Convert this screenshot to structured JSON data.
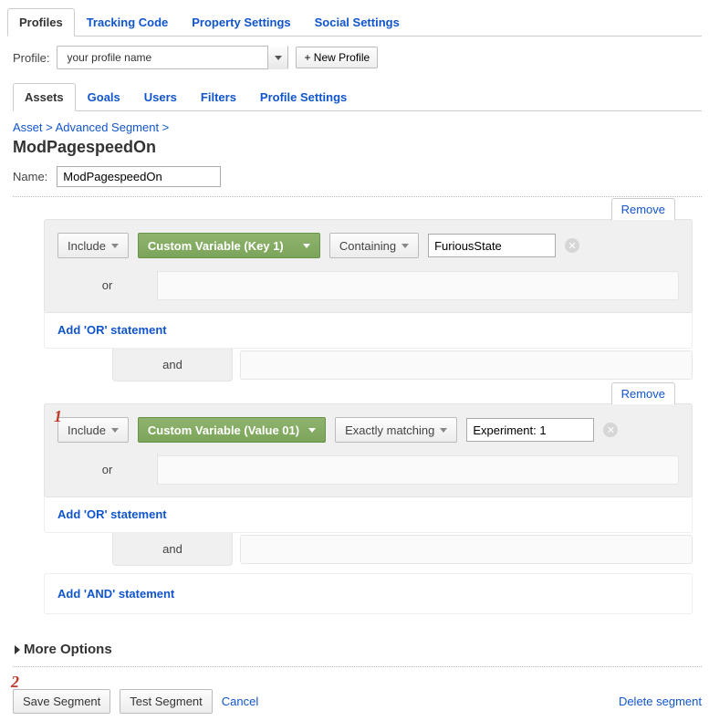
{
  "topTabs": [
    "Profiles",
    "Tracking Code",
    "Property Settings",
    "Social Settings"
  ],
  "topActive": "Profiles",
  "profileLabel": "Profile:",
  "profileValue": "your profile name",
  "newProfileLabel": "+ New Profile",
  "subTabs": [
    "Assets",
    "Goals",
    "Users",
    "Filters",
    "Profile Settings"
  ],
  "subActive": "Assets",
  "breadcrumb": "Asset > Advanced Segment >",
  "segmentTitle": "ModPagespeedOn",
  "nameLabel": "Name:",
  "nameValue": "ModPagespeedOn",
  "orLabel": "or",
  "andLabel": "and",
  "addOrLabel": "Add 'OR' statement",
  "addAndLabel": "Add 'AND' statement",
  "removeLabel": "Remove",
  "rules": [
    {
      "include": "Include",
      "variable": "Custom Variable (Key 1)",
      "match": "Containing",
      "value": "FuriousState"
    },
    {
      "include": "Include",
      "variable": "Custom Variable (Value 01)",
      "match": "Exactly matching",
      "value": "Experiment: 1"
    }
  ],
  "moreOptions": "More Options",
  "saveLabel": "Save Segment",
  "testLabel": "Test Segment",
  "cancelLabel": "Cancel",
  "deleteLabel": "Delete segment",
  "annotations": {
    "one": "1",
    "two": "2"
  }
}
